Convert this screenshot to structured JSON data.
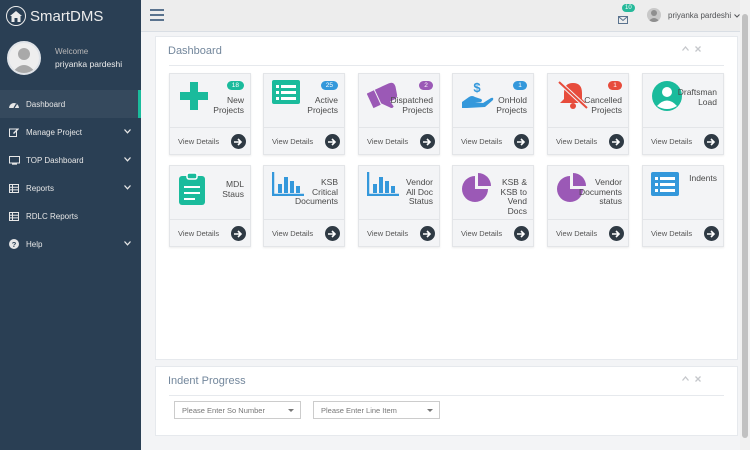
{
  "app": {
    "title": "SmartDMS"
  },
  "profile": {
    "welcome": "Welcome",
    "name": "priyanka pardeshi"
  },
  "sidebar": {
    "items": [
      {
        "label": "Dashboard",
        "icon": "dashboard-icon"
      },
      {
        "label": "Manage Project",
        "icon": "edit-icon"
      },
      {
        "label": "TOP Dashboard",
        "icon": "monitor-icon"
      },
      {
        "label": "Reports",
        "icon": "table-icon"
      },
      {
        "label": "RDLC Reports",
        "icon": "table-icon"
      },
      {
        "label": "Help",
        "icon": "help-icon"
      }
    ]
  },
  "topbar": {
    "mail_count": "10",
    "user": "priyanka pardeshi"
  },
  "dashboard": {
    "title": "Dashboard",
    "view_details": "View Details",
    "tiles": [
      {
        "label": [
          "New",
          "Projects"
        ],
        "badge": "18",
        "badge_color": "#1abb9c",
        "icon_color": "#1abb9c"
      },
      {
        "label": [
          "Active",
          "Projects"
        ],
        "badge": "25",
        "badge_color": "#3498db",
        "icon_color": "#1abb9c"
      },
      {
        "label": [
          "Dispatched",
          "Projects"
        ],
        "badge": "2",
        "badge_color": "#9b59b6",
        "icon_color": "#9b59b6"
      },
      {
        "label": [
          "OnHold",
          "Projects"
        ],
        "badge": "1",
        "badge_color": "#3498db",
        "icon_color": "#3498db"
      },
      {
        "label": [
          "Cancelled",
          "Projects"
        ],
        "badge": "1",
        "badge_color": "#e74c3c",
        "icon_color": "#e74c3c"
      },
      {
        "label": [
          "Draftsman",
          "Load"
        ],
        "icon_color": "#1abb9c"
      },
      {
        "label": [
          "MDL",
          "Staus"
        ],
        "icon_color": "#1abb9c"
      },
      {
        "label": [
          "KSB",
          "Critical",
          "Documents"
        ],
        "icon_color": "#3498db"
      },
      {
        "label": [
          "Vendor",
          "All Doc",
          "Status"
        ],
        "icon_color": "#3498db"
      },
      {
        "label": [
          "KSB &",
          "KSB to",
          "Vend",
          "Docs"
        ],
        "icon_color": "#9b59b6"
      },
      {
        "label": [
          "Vendor",
          "Documents",
          "status"
        ],
        "icon_color": "#9b59b6"
      },
      {
        "label": [
          "Indents"
        ],
        "icon_color": "#3498db"
      }
    ]
  },
  "indent": {
    "title": "Indent Progress",
    "so_placeholder": "Please Enter So Number",
    "line_placeholder": "Please Enter Line Item"
  }
}
